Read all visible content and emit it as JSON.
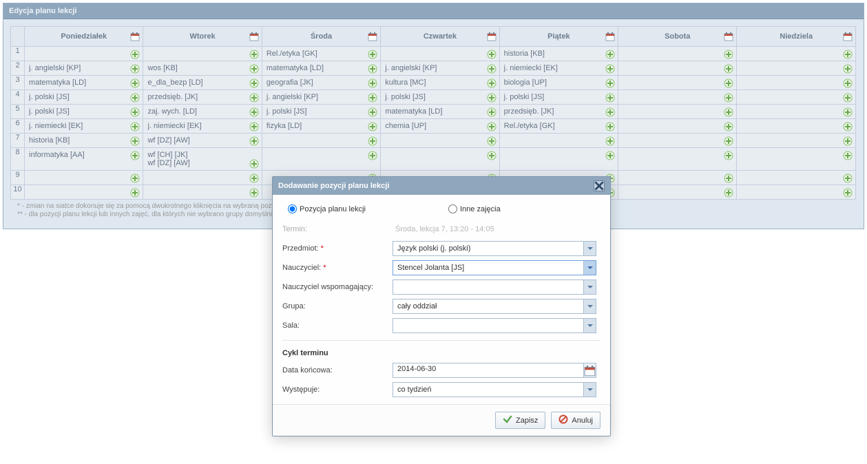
{
  "panel": {
    "title": "Edycja planu lekcji"
  },
  "days": [
    "Poniedziałek",
    "Wtorek",
    "Środa",
    "Czwartek",
    "Piątek",
    "Sobota",
    "Niedziela"
  ],
  "rows": [
    {
      "n": "1",
      "cells": [
        "",
        "",
        "Rel./etyka [GK]",
        "",
        "historia [KB]",
        "",
        ""
      ]
    },
    {
      "n": "2",
      "cells": [
        "j. angielski [KP]",
        "wos [KB]",
        "matematyka [LD]",
        "j. angielski [KP]",
        "j. niemiecki [EK]",
        "",
        ""
      ]
    },
    {
      "n": "3",
      "cells": [
        "matematyka [LD]",
        "e_dla_bezp [LD]",
        "geografia [JK]",
        "kultura [MC]",
        "biologia [UP]",
        "",
        ""
      ]
    },
    {
      "n": "4",
      "cells": [
        "j. polski [JS]",
        "przedsięb. [JK]",
        "j. angielski [KP]",
        "j. polski [JS]",
        "j. polski [JS]",
        "",
        ""
      ]
    },
    {
      "n": "5",
      "cells": [
        "j. polski [JS]",
        "zaj. wych. [LD]",
        "j. polski [JS]",
        "matematyka [LD]",
        "przedsięb. [JK]",
        "",
        ""
      ]
    },
    {
      "n": "6",
      "cells": [
        "j. niemiecki [EK]",
        "j. niemiecki [EK]",
        "fizyka [LD]",
        "chemia [UP]",
        "Rel./etyka [GK]",
        "",
        ""
      ]
    },
    {
      "n": "7",
      "cells": [
        "historia [KB]",
        "wf [DZ] [AW]",
        "",
        "",
        "",
        "",
        ""
      ]
    },
    {
      "n": "8",
      "cells": [
        "informatyka [AA]",
        "wf [CH] [JK]\nwf [DZ] [AW]",
        "",
        "",
        "",
        "",
        ""
      ]
    },
    {
      "n": "9",
      "cells": [
        "",
        "",
        "",
        "",
        "",
        "",
        ""
      ]
    },
    {
      "n": "10",
      "cells": [
        "",
        "",
        "",
        "",
        "",
        "",
        ""
      ]
    }
  ],
  "footnotes": {
    "l1": "* - zmian na siatce dokonuje się za pomocą dwukrotnego kliknięcia na wybraną pozycję",
    "l2": "** - dla pozycji planu lekcji lub innych zajęć, dla których nie wybrano grupy domyślnie z"
  },
  "modal": {
    "title": "Dodawanie pozycji planu lekcji",
    "radio1": "Pozycja planu lekcji",
    "radio2": "Inne zajęcia",
    "labels": {
      "termin": "Termin:",
      "przedmiot": "Przedmiot:",
      "nauczyciel": "Nauczyciel:",
      "wspom": "Nauczyciel wspomagający:",
      "grupa": "Grupa:",
      "sala": "Sala:",
      "cykl": "Cykl terminu",
      "datakon": "Data końcowa:",
      "wyst": "Występuje:"
    },
    "values": {
      "termin": "Środa, lekcja 7, 13:20 - 14:05",
      "przedmiot": "Język polski (j. polski)",
      "nauczyciel": "Stencel Jolanta [JS]",
      "wspom": "",
      "grupa": "cały oddział",
      "sala": "",
      "datakon": "2014-06-30",
      "wyst": "co tydzień"
    },
    "buttons": {
      "save": "Zapisz",
      "cancel": "Anuluj"
    }
  }
}
